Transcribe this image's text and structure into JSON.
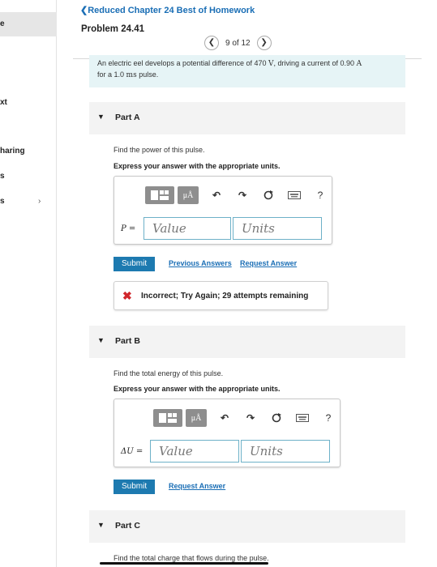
{
  "sidebar": {
    "items": [
      {
        "label": "e"
      },
      {
        "label": "xt"
      },
      {
        "label": "haring"
      },
      {
        "label": "s"
      },
      {
        "label": "s"
      }
    ],
    "chevron": "›"
  },
  "header": {
    "back_link": "❮Reduced Chapter 24 Best of Homework",
    "problem_title": "Problem 24.41",
    "pager": {
      "prev": "❮",
      "text": "9 of 12",
      "next": "❯"
    }
  },
  "statement": {
    "text_a": "An electric eel develops a potential difference of 470",
    "unit_v": "V",
    "text_b": ", driving a current of 0.90",
    "unit_a": "A",
    "text_c": "for a 1.0",
    "unit_ms": "ms",
    "text_d": "pulse."
  },
  "parts": [
    {
      "title": "Part A",
      "question": "Find the power of this pulse.",
      "instruction": "Express your answer with the appropriate units.",
      "symbol": "P =",
      "value_placeholder": "Value",
      "units_placeholder": "Units",
      "submit_label": "Submit",
      "prev_answers_label": "Previous Answers",
      "request_answer_label": "Request Answer",
      "feedback": "Incorrect; Try Again; 29 attempts remaining"
    },
    {
      "title": "Part B",
      "question": "Find the total energy of this pulse.",
      "instruction": "Express your answer with the appropriate units.",
      "symbol": "ΔU =",
      "value_placeholder": "Value",
      "units_placeholder": "Units",
      "submit_label": "Submit",
      "request_answer_label": "Request Answer"
    },
    {
      "title": "Part C",
      "question": "Find the total charge that flows during the pulse."
    }
  ],
  "toolbar": {
    "mu_label": "μÅ",
    "help_label": "?",
    "icons": [
      "templates-icon",
      "units-icon",
      "undo-icon",
      "redo-icon",
      "reset-icon",
      "keyboard-icon",
      "help-icon"
    ]
  },
  "colors": {
    "link": "#1a6eb5",
    "submit": "#1d7ab0",
    "statement_bg": "#e6f4f6",
    "field_border": "#6db1c8",
    "error": "#d0262c",
    "toolbar_btn": "#8e8e8e"
  }
}
